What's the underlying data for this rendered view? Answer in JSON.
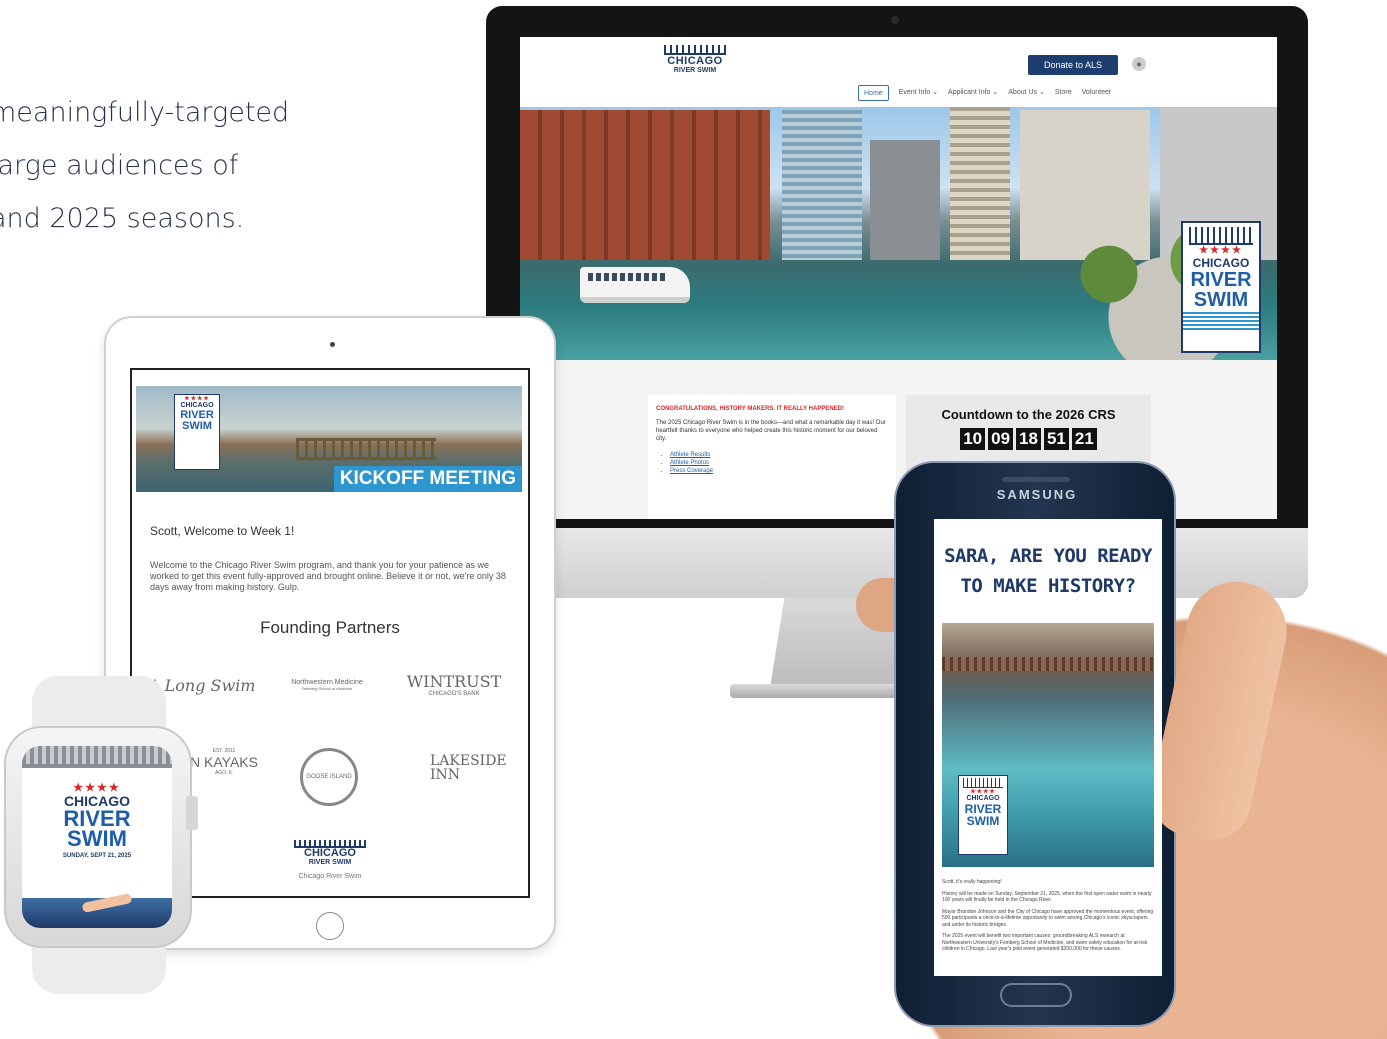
{
  "intro": {
    "line1": "meaningfully-targeted",
    "line2": "large audiences of",
    "line3": "and 2025 seasons."
  },
  "desktop": {
    "logo_line1": "CHICAGO",
    "logo_line2": "RIVER SWIM",
    "donate_label": "Donate to ALS",
    "nav": [
      "Home",
      "Event Info ⌄",
      "Applicant Info ⌄",
      "About Us ⌄",
      "Store",
      "Volunteer"
    ],
    "badge": {
      "stars": "★★★★",
      "line1": "CHICAGO",
      "line2": "RIVER",
      "line3": "SWIM"
    },
    "congrats_heading": "CONGRATULATIONS, HISTORY MAKERS. IT REALLY HAPPENED!",
    "congrats_body": "The 2025 Chicago River Swim is in the books—and what a remarkable day it was! Our heartfelt thanks to everyone who helped create this historic moment for our beloved city.",
    "links": [
      "Athlete Results",
      "Athlete Photos",
      "Press Coverage"
    ],
    "countdown_title": "Countdown to the 2026 CRS",
    "countdown": [
      "10",
      "09",
      "18",
      "51",
      "21"
    ]
  },
  "tablet": {
    "badge": {
      "stars": "★★★★",
      "line1": "CHICAGO",
      "line2": "RIVER",
      "line3": "SWIM"
    },
    "banner": "KICKOFF MEETING",
    "greeting": "Scott, Welcome to Week 1!",
    "body": "Welcome to the Chicago River Swim program, and thank you for your patience as we worked to get this event fully-approved and brought online. Believe it or not, we're only 38 days away from making history. Gulp.",
    "partners_title": "Founding Partners",
    "partners": {
      "along": "A Long Swim",
      "northwestern": "Northwestern Medicine",
      "northwestern_sub": "Feinberg School of Medicine",
      "wintrust": "WINTRUST",
      "wintrust_sub": "CHICAGO'S BANK",
      "kayaks_pre": "EST. 2011",
      "kayaks": "N KAYAKS",
      "kayaks_sub": "AGO, IL",
      "goose": "GOOSE ISLAND",
      "lakeside1": "LAKESIDE",
      "lakeside2": "INN"
    },
    "footer_logo1": "CHICAGO",
    "footer_logo2": "RIVER SWIM",
    "footer_caption": "Chicago River Swim"
  },
  "watch": {
    "stars": "★★★★",
    "line1": "CHICAGO",
    "line2": "RIVER",
    "line3": "SWIM",
    "date": "SUNDAY, SEPT 21, 2025"
  },
  "phone": {
    "brand": "SAMSUNG",
    "headline1": "SARA, ARE YOU READY",
    "headline2": "TO MAKE HISTORY?",
    "badge": {
      "stars": "★★★★",
      "line1": "CHICAGO",
      "line2": "RIVER",
      "line3": "SWIM"
    },
    "p1": "Scott, it's really happening!",
    "p2": "History will be made on Sunday, September 21, 2025, when the first open water swim in nearly 100 years will finally be held in the Chicago River.",
    "p3": "Mayor Brandon Johnson and the City of Chicago have approved the momentous event, offering 500 participants a once-in-a-lifetime opportunity to swim among Chicago's iconic skyscrapers and under its historic bridges.",
    "p4": "The 2025 event will benefit two important causes: groundbreaking ALS research at Northwestern University's Feinberg School of Medicine, and swim safety education for at-risk children in Chicago. Last year's pilot event generated $200,000 for these causes."
  },
  "colors": {
    "navy": "#1f3a69",
    "blue": "#2d96cf",
    "red": "#d8262a"
  }
}
